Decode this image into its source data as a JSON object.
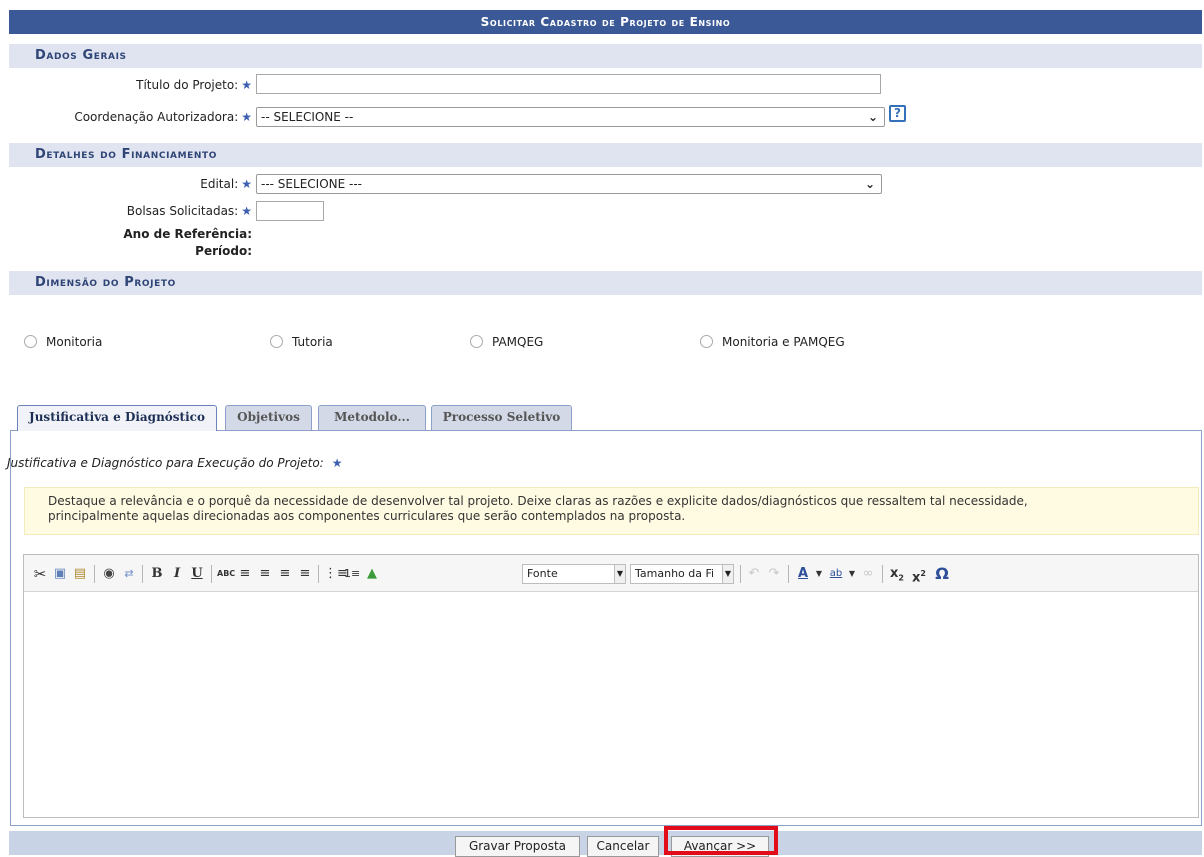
{
  "header": {
    "title": "Solicitar Cadastro de Projeto de Ensino"
  },
  "dados_gerais": {
    "section_title": "Dados Gerais",
    "titulo_label": "Título do Projeto:",
    "titulo_value": "",
    "coordenacao_label": "Coordenação Autorizadora:",
    "coordenacao_value": "-- SELECIONE --",
    "help_icon": "?"
  },
  "financiamento": {
    "section_title": "Detalhes do Financiamento",
    "edital_label": "Edital:",
    "edital_value": "--- SELECIONE ---",
    "bolsas_label": "Bolsas Solicitadas:",
    "bolsas_value": "",
    "ano_label": "Ano de Referência:",
    "periodo_label": "Período:"
  },
  "dimensao": {
    "section_title": "Dimensão do Projeto",
    "options": [
      "Monitoria",
      "Tutoria",
      "PAMQEG",
      "Monitoria e PAMQEG"
    ]
  },
  "tabs": [
    {
      "label": "Justificativa e Diagnóstico",
      "active": true
    },
    {
      "label": "Objetivos",
      "active": false
    },
    {
      "label": "Metodolo...",
      "active": false
    },
    {
      "label": "Processo Seletivo",
      "active": false
    }
  ],
  "justificativa": {
    "label": "Justificativa e Diagnóstico para Execução do Projeto:",
    "hint_line1": "Destaque a relevância e o porquê da necessidade de desenvolver tal projeto. Deixe claras as razões e explicite dados/diagnósticos que ressaltem tal necessidade,",
    "hint_line2": "principalmente aquelas direcionadas aos componentes curriculares que serão contemplados na proposta."
  },
  "editor": {
    "font_select": "Fonte",
    "size_select": "Tamanho da Fi",
    "icons": [
      "cut-icon",
      "copy-icon",
      "paste-icon",
      "find-icon",
      "replace-icon",
      "bold-icon",
      "italic-icon",
      "underline-icon",
      "spellcheck-icon",
      "align-left-icon",
      "align-center-icon",
      "align-right-icon",
      "align-justify-icon",
      "bullet-list-icon",
      "numbered-list-icon",
      "image-icon",
      "undo-icon",
      "redo-icon",
      "text-color-icon",
      "highlight-color-icon",
      "link-icon",
      "subscript-icon",
      "superscript-icon",
      "special-char-icon"
    ]
  },
  "footer": {
    "gravar_label": "Gravar Proposta",
    "cancelar_label": "Cancelar",
    "avancar_label": "Avançar >>"
  },
  "colors": {
    "header_bg": "#3b5997",
    "section_bg": "#dfe4f0",
    "highlight": "#e10b1a",
    "star": "#3c5fb0"
  }
}
